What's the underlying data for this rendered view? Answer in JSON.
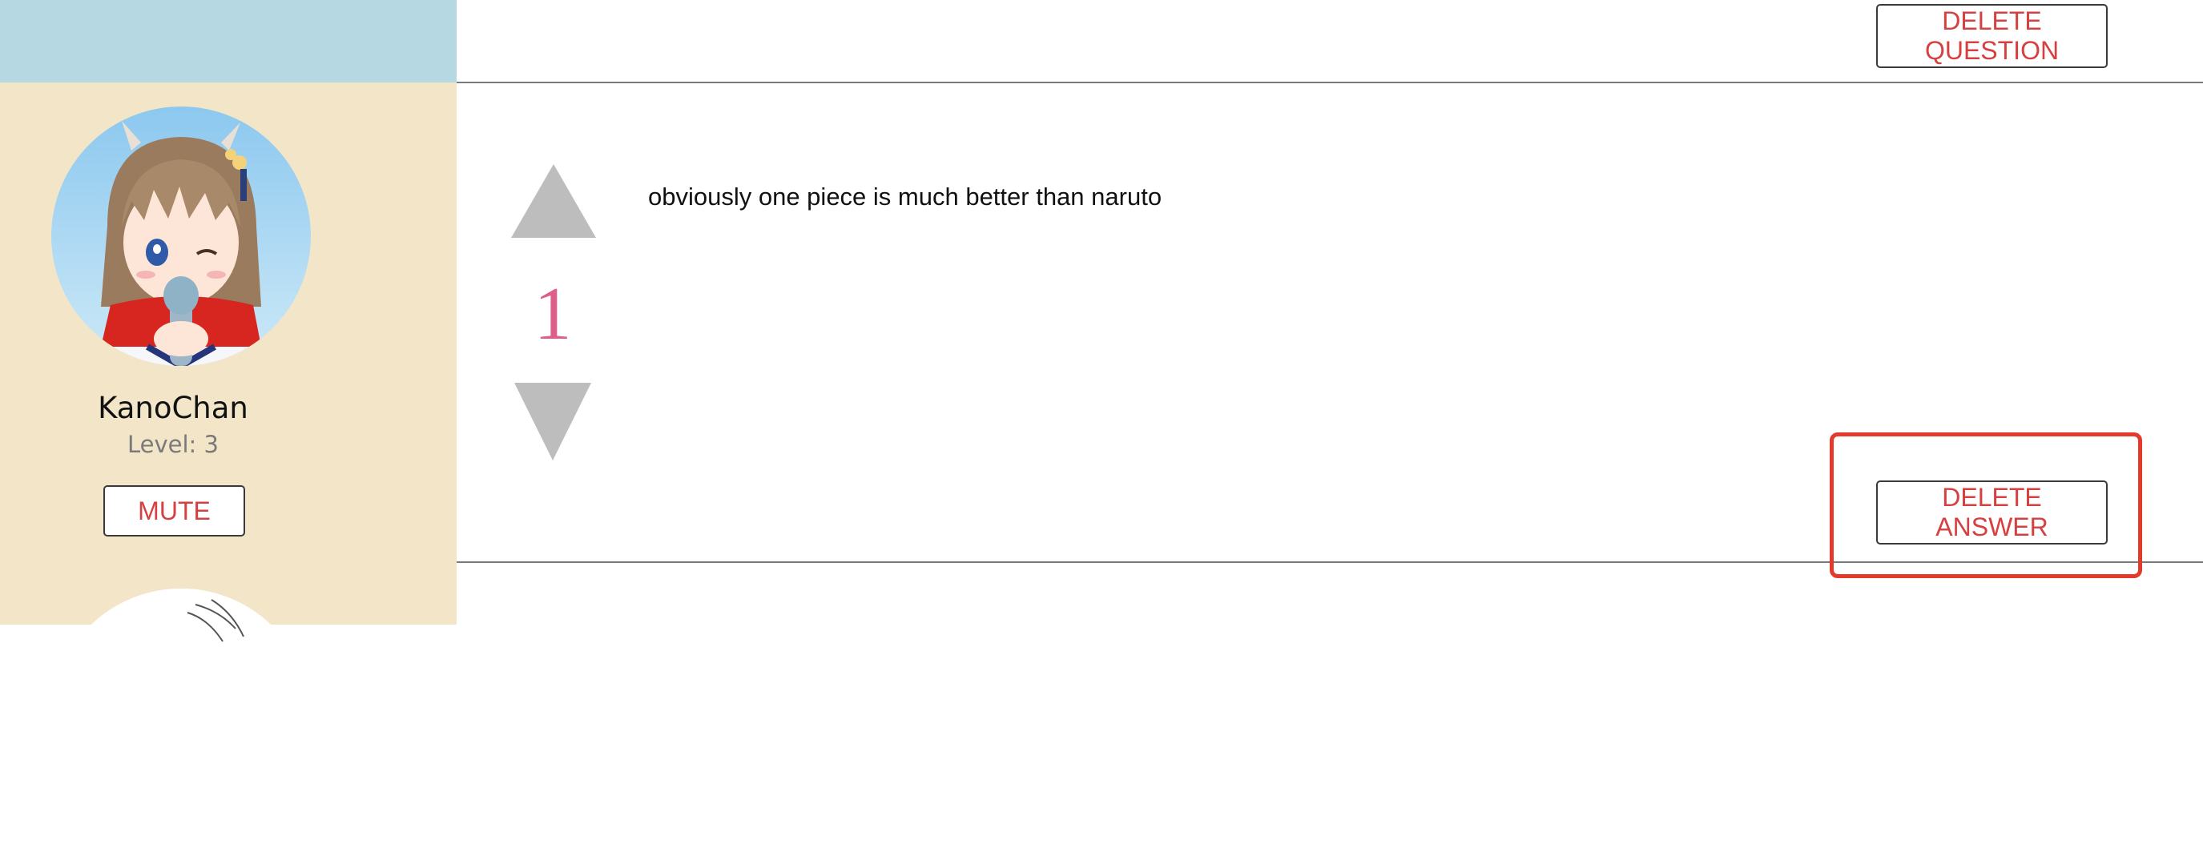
{
  "theme": {
    "question_band_color": "#b5d8e3",
    "answer_band_color": "#f3e6c8",
    "action_red": "#d64040",
    "vote_count_color": "#de5f88",
    "vote_arrow_color": "#bdbdbd",
    "highlight_color": "#e4392b"
  },
  "question": {
    "delete_label": "DELETE\nQUESTION"
  },
  "answer": {
    "author": {
      "username": "KanoChan",
      "level": "Level: 3",
      "mute_label": "MUTE",
      "avatar_icon": "anime-girl-avatar"
    },
    "votes": {
      "upvote_icon": "triangle-up-icon",
      "count": "1",
      "downvote_icon": "triangle-down-icon"
    },
    "text": "obviously one piece is much better than naruto",
    "delete_label": "DELETE\nANSWER"
  }
}
